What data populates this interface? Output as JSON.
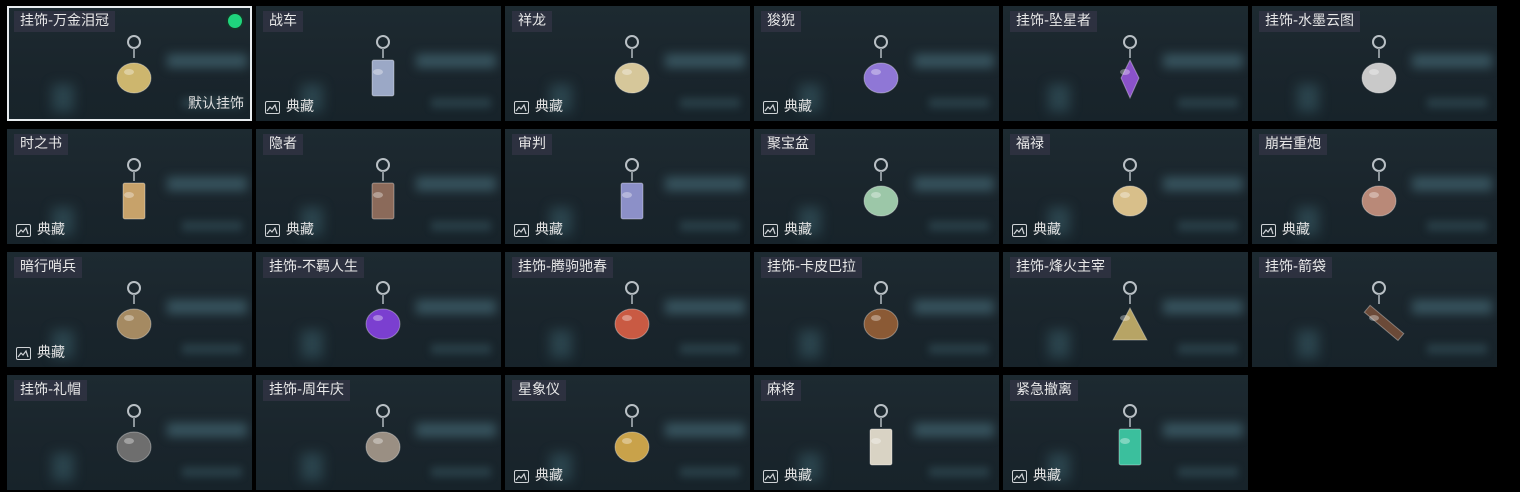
{
  "accent_selected": "#e8ecef",
  "status_color": "#1fd57d",
  "items": [
    {
      "title": "挂饰-万金泪冠",
      "collect": "",
      "default_label": "默认挂饰",
      "selected": true,
      "status_dot": true,
      "icon": "crown-charm-icon",
      "color": "#cdb66e"
    },
    {
      "title": "战车",
      "collect": "典藏",
      "icon": "tarot-chariot-charm-icon",
      "color": "#9ba8c6"
    },
    {
      "title": "祥龙",
      "collect": "典藏",
      "icon": "dragon-charm-icon",
      "color": "#d6c79a"
    },
    {
      "title": "狻猊",
      "collect": "典藏",
      "icon": "lion-charm-icon",
      "color": "#8f77d6"
    },
    {
      "title": "挂饰-坠星者",
      "collect": "",
      "icon": "star-crystal-charm-icon",
      "color": "#8a52c9"
    },
    {
      "title": "挂饰-水墨云图",
      "collect": "",
      "icon": "ink-ball-charm-icon",
      "color": "#c9c9c9"
    },
    {
      "title": "时之书",
      "collect": "典藏",
      "icon": "book-charm-icon",
      "color": "#c7a26a"
    },
    {
      "title": "隐者",
      "collect": "典藏",
      "icon": "tarot-hermit-charm-icon",
      "color": "#8b6a5a"
    },
    {
      "title": "审判",
      "collect": "典藏",
      "icon": "tarot-judgement-charm-icon",
      "color": "#8c90c8"
    },
    {
      "title": "聚宝盆",
      "collect": "典藏",
      "icon": "treasure-bowl-charm-icon",
      "color": "#9cc7a8"
    },
    {
      "title": "福禄",
      "collect": "典藏",
      "icon": "gourd-charm-icon",
      "color": "#d8bf8a"
    },
    {
      "title": "崩岩重炮",
      "collect": "典藏",
      "icon": "rock-cannon-charm-icon",
      "color": "#b98978"
    },
    {
      "title": "暗行哨兵",
      "collect": "典藏",
      "icon": "sentinel-charm-icon",
      "color": "#a58a62"
    },
    {
      "title": "挂饰-不羁人生",
      "collect": "",
      "icon": "sneaker-charm-icon",
      "color": "#7b3fd0"
    },
    {
      "title": "挂饰-腾驹驰春",
      "collect": "",
      "icon": "carriage-charm-icon",
      "color": "#c95a43"
    },
    {
      "title": "挂饰-卡皮巴拉",
      "collect": "",
      "icon": "capybara-charm-icon",
      "color": "#8b5a35"
    },
    {
      "title": "挂饰-烽火主宰",
      "collect": "",
      "icon": "triangle-badge-charm-icon",
      "color": "#b7a465"
    },
    {
      "title": "挂饰-箭袋",
      "collect": "",
      "icon": "quiver-charm-icon",
      "color": "#6b4a38"
    },
    {
      "title": "挂饰-礼帽",
      "collect": "",
      "icon": "hat-charm-icon",
      "color": "#6e6e6e"
    },
    {
      "title": "挂饰-周年庆",
      "collect": "",
      "icon": "anniversary-2-charm-icon",
      "color": "#9a8f83"
    },
    {
      "title": "星象仪",
      "collect": "典藏",
      "icon": "astrolabe-charm-icon",
      "color": "#c9a24a"
    },
    {
      "title": "麻将",
      "collect": "典藏",
      "icon": "mahjong-tile-charm-icon",
      "color": "#d9d3c4"
    },
    {
      "title": "紧急撤离",
      "collect": "典藏",
      "icon": "exit-sign-charm-icon",
      "color": "#3bbf9d"
    }
  ]
}
